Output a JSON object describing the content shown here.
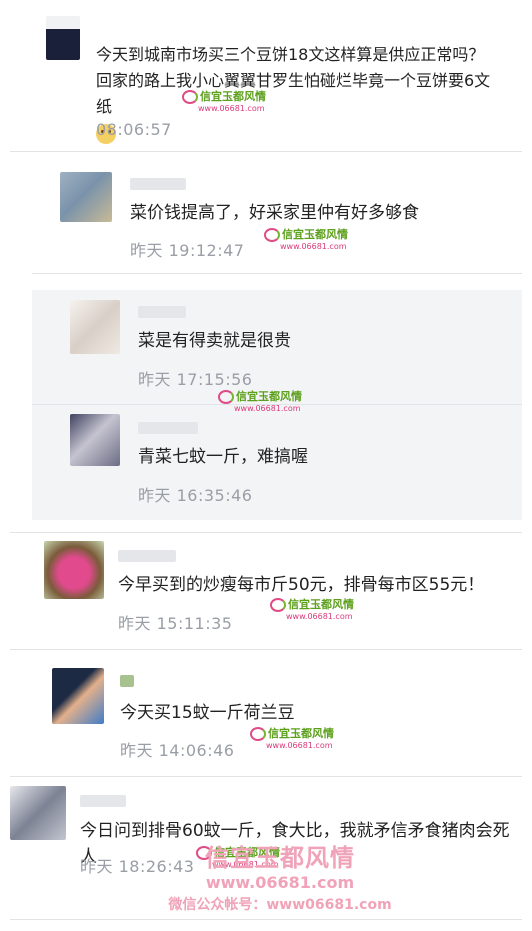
{
  "comments": [
    {
      "text": "今天到城南市场买三个豆饼18文这样算是供应正常吗？回家的路上我小心翼翼甘罗生怕碰烂毕竟一个豆饼要6文纸",
      "time": "08:06:57",
      "avatar_colors": [
        "#f1f2f4",
        "#1a1f3a",
        "#c9ccd3"
      ]
    },
    {
      "text": "菜价钱提高了，好采家里仲有好多够食",
      "time": "昨天 19:12:47",
      "avatar_colors": [
        "#9fb1c2",
        "#c8ba96",
        "#7a93ab"
      ]
    },
    {
      "text": "菜是有得卖就是很贵",
      "time": "昨天 17:15:56",
      "avatar_colors": [
        "#efe9e3",
        "#d8cfc7",
        "#f6f2ee"
      ]
    },
    {
      "text": "青菜七蚊一斤，难搞喔",
      "time": "昨天 16:35:46",
      "avatar_colors": [
        "#6d6e86",
        "#c5c3cf",
        "#3f4261"
      ]
    },
    {
      "text": "今早买到的炒瘦每市斤50元，排骨每市区55元！",
      "time": "昨天 15:11:35",
      "avatar_colors": [
        "#e24a8e",
        "#7a5b3a",
        "#c8d7b0"
      ]
    },
    {
      "text": "今天买15蚊一斤荷兰豆",
      "time": "昨天 14:06:46",
      "avatar_colors": [
        "#1d2a44",
        "#e3b08c",
        "#3f7cc7"
      ]
    },
    {
      "text": "今日问到排骨60蚊一斤，食大比，我就矛信矛食猪肉会死人",
      "time": "昨天 18:26:43",
      "avatar_colors": [
        "#c3c6d0",
        "#7d8294",
        "#e6e7ec"
      ]
    }
  ],
  "watermark": {
    "brand": "信宜玉都风情",
    "url": "www.06681.com",
    "big_brand": "信宜玉都风情",
    "big_domain": "www.06681.com",
    "wechat": "微信公众帐号：www06681.com"
  }
}
